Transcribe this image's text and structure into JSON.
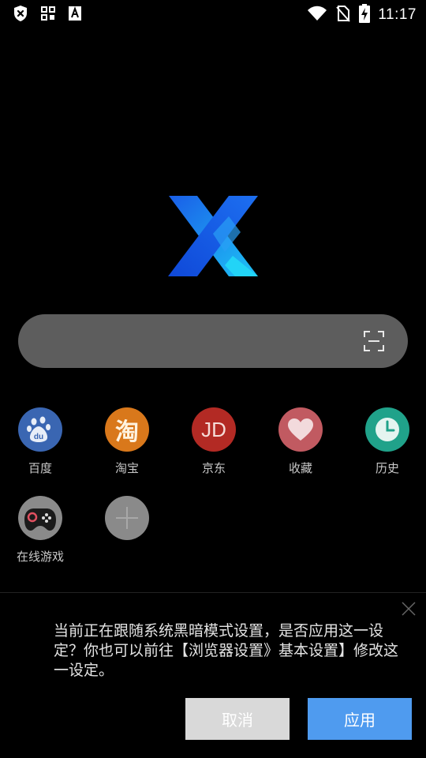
{
  "status_bar": {
    "time": "11:17",
    "icons": [
      "shield-x-icon",
      "qr-grid-icon",
      "font-a-icon",
      "wifi-icon",
      "no-sim-icon",
      "battery-charging-icon"
    ]
  },
  "logo": {
    "name": "x-browser-logo"
  },
  "search": {
    "placeholder": "",
    "icon": "scan-icon"
  },
  "shortcuts": [
    {
      "label": "百度",
      "icon": "baidu-icon",
      "color": "#3a66b2",
      "glyph": "du"
    },
    {
      "label": "淘宝",
      "icon": "taobao-icon",
      "color": "#d9781b",
      "glyph": "淘"
    },
    {
      "label": "京东",
      "icon": "jd-icon",
      "color": "#b32a24",
      "glyph": "JD"
    },
    {
      "label": "收藏",
      "icon": "heart-icon",
      "color": "#c15a61",
      "glyph": ""
    },
    {
      "label": "历史",
      "icon": "clock-icon",
      "color": "#20a28a",
      "glyph": ""
    },
    {
      "label": "在线游戏",
      "icon": "gamepad-icon",
      "color": "#2b2b2b",
      "glyph": ""
    },
    {
      "label": "",
      "icon": "add-icon",
      "color": "#888888",
      "glyph": "+"
    }
  ],
  "dialog": {
    "message": "当前正在跟随系统黑暗模式设置，是否应用这一设定？你也可以前往【浏览器设置》基本设置】修改这一设定。",
    "cancel_label": "取消",
    "apply_label": "应用"
  }
}
